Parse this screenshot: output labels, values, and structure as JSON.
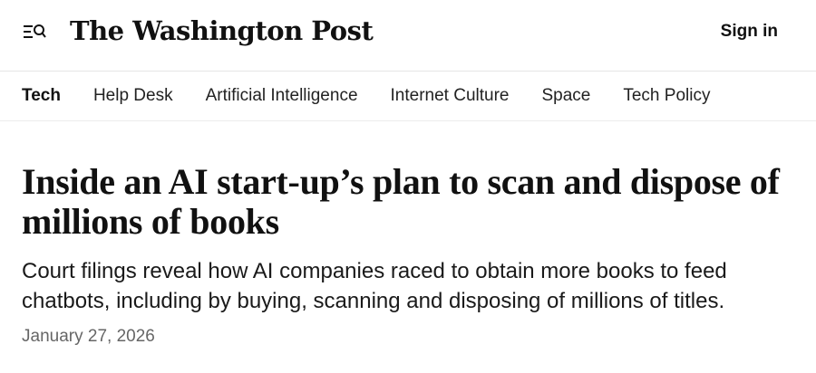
{
  "header": {
    "logo_text": "The Washington Post",
    "signin_label": "Sign in",
    "menu_icon": "menu-search-icon"
  },
  "nav": {
    "items": [
      {
        "label": "Tech",
        "active": true
      },
      {
        "label": "Help Desk",
        "active": false
      },
      {
        "label": "Artificial Intelligence",
        "active": false
      },
      {
        "label": "Internet Culture",
        "active": false
      },
      {
        "label": "Space",
        "active": false
      },
      {
        "label": "Tech Policy",
        "active": false
      }
    ]
  },
  "article": {
    "headline": "Inside an AI start-up’s plan to scan and dispose of millions of books",
    "dek": "Court filings reveal how AI companies raced to obtain more books to feed chatbots, including by buying, scanning and disposing of millions of titles.",
    "date": "January 27, 2026"
  },
  "colors": {
    "text": "#111111",
    "muted": "#666666",
    "divider": "#e6e6e6"
  }
}
